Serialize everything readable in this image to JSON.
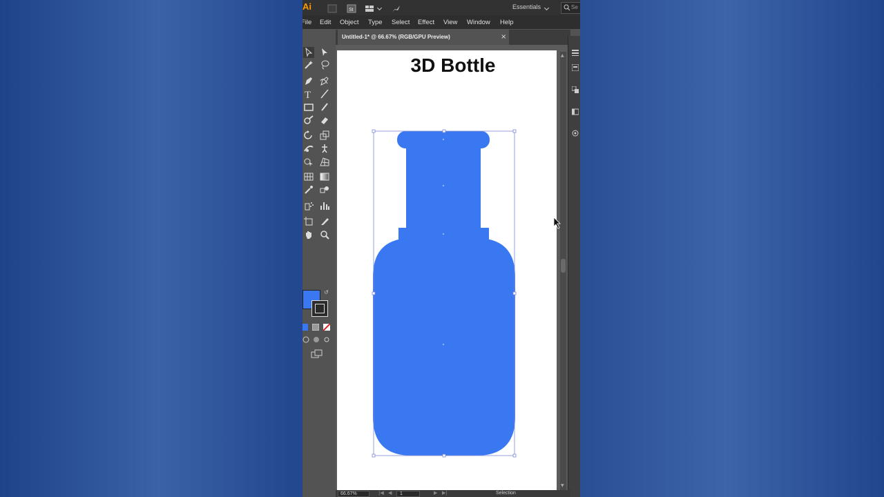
{
  "app": {
    "logo": "Ai",
    "workspace": "Essentials",
    "search_placeholder": "Se"
  },
  "menu": [
    "File",
    "Edit",
    "Object",
    "Type",
    "Select",
    "Effect",
    "View",
    "Window",
    "Help"
  ],
  "document": {
    "tab_title": "Untitled-1* @ 66.67% (RGB/GPU Preview)",
    "close_glyph": "×"
  },
  "artboard": {
    "title": "3D Bottle"
  },
  "colors": {
    "fill": "#3a78f2",
    "stroke": "#2a2a2a",
    "accent": "#ff9a00"
  },
  "tools": [
    "selection-tool",
    "direct-selection-tool",
    "magic-wand-tool",
    "lasso-tool",
    "pen-tool",
    "curvature-tool",
    "type-tool",
    "line-segment-tool",
    "rectangle-tool",
    "paintbrush-tool",
    "shaper-tool",
    "eraser-tool",
    "rotate-tool",
    "scale-tool",
    "width-tool",
    "puppet-warp-tool",
    "shape-builder-tool",
    "perspective-grid-tool",
    "mesh-tool",
    "gradient-tool",
    "eyedropper-tool",
    "blend-tool",
    "symbol-sprayer-tool",
    "column-graph-tool",
    "artboard-tool",
    "slice-tool",
    "hand-tool",
    "zoom-tool"
  ],
  "status": {
    "zoom": "66.67%",
    "artboard_number": "1",
    "tool": "Selection"
  }
}
